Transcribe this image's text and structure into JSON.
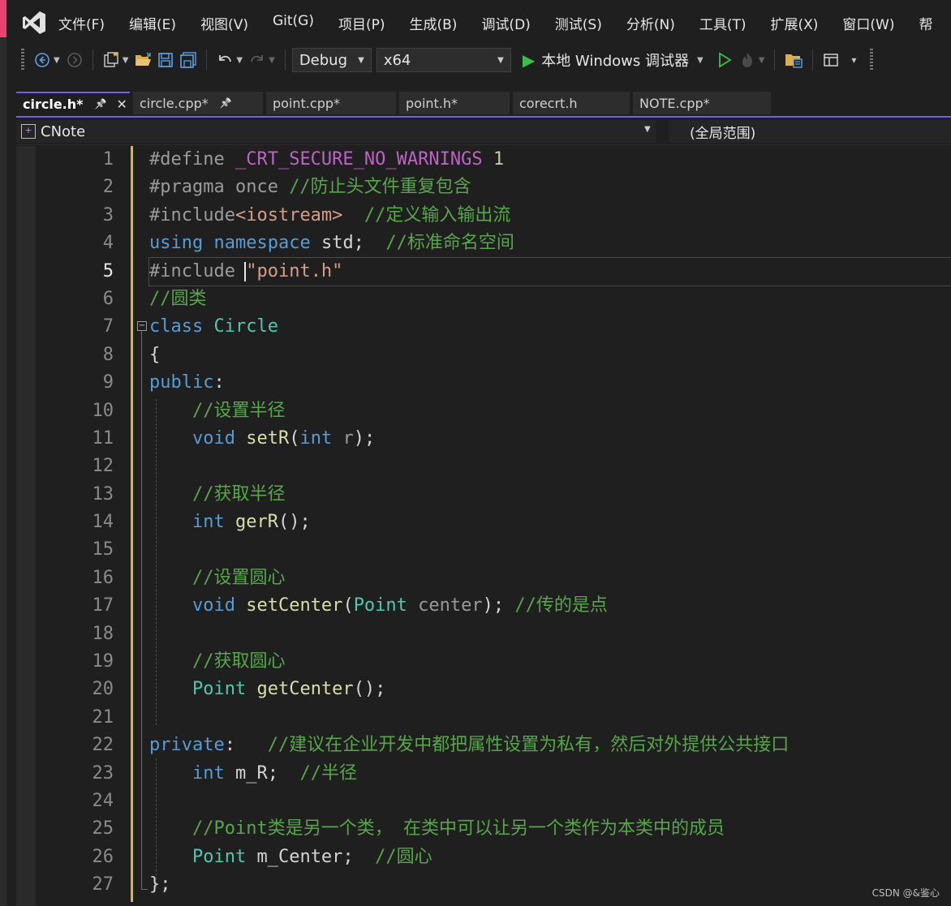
{
  "menu": [
    "文件(F)",
    "编辑(E)",
    "视图(V)",
    "Git(G)",
    "项目(P)",
    "生成(B)",
    "调试(D)",
    "测试(S)",
    "分析(N)",
    "工具(T)",
    "扩展(X)",
    "窗口(W)",
    "帮"
  ],
  "toolbar": {
    "config": "Debug",
    "platform": "x64",
    "run_label": "本地 Windows 调试器"
  },
  "tabs": [
    {
      "label": "circle.h*"
    },
    {
      "label": "circle.cpp*"
    },
    {
      "label": "point.cpp*"
    },
    {
      "label": "point.h*"
    },
    {
      "label": "corecrt.h"
    },
    {
      "label": "NOTE.cpp*"
    }
  ],
  "nav": {
    "class": "CNote",
    "scope": "(全局范围)"
  },
  "line_numbers": [
    "1",
    "2",
    "3",
    "4",
    "5",
    "6",
    "7",
    "8",
    "9",
    "10",
    "11",
    "12",
    "13",
    "14",
    "15",
    "16",
    "17",
    "18",
    "19",
    "20",
    "21",
    "22",
    "23",
    "24",
    "25",
    "26",
    "27"
  ],
  "code": [
    [
      {
        "t": "#define ",
        "c": "pp"
      },
      {
        "t": "_CRT_SECURE_NO_WARNINGS",
        "c": "mac"
      },
      {
        "t": " 1",
        "c": "num"
      }
    ],
    [
      {
        "t": "#pragma once ",
        "c": "pp"
      },
      {
        "t": "//防止头文件重复包含",
        "c": "cm"
      }
    ],
    [
      {
        "t": "#include",
        "c": "pp"
      },
      {
        "t": "<iostream>",
        "c": "inc"
      },
      {
        "t": "  ",
        "c": "pl"
      },
      {
        "t": "//定义输入输出流",
        "c": "cm"
      }
    ],
    [
      {
        "t": "using",
        "c": "kw"
      },
      {
        "t": " ",
        "c": "pl"
      },
      {
        "t": "namespace",
        "c": "kw"
      },
      {
        "t": " std;  ",
        "c": "pl"
      },
      {
        "t": "//标准命名空间",
        "c": "cm"
      }
    ],
    [
      {
        "t": "#include ",
        "c": "pp"
      },
      {
        "t": "\"point.h\"",
        "c": "str"
      }
    ],
    [
      {
        "t": "//圆类",
        "c": "cm"
      }
    ],
    [
      {
        "t": "class",
        "c": "kw"
      },
      {
        "t": " ",
        "c": "pl"
      },
      {
        "t": "Circle",
        "c": "ty"
      }
    ],
    [
      {
        "t": "{",
        "c": "pl"
      }
    ],
    [
      {
        "t": "public",
        "c": "kw"
      },
      {
        "t": ":",
        "c": "pl"
      }
    ],
    [
      {
        "t": "    ",
        "c": "pl"
      },
      {
        "t": "//设置半径",
        "c": "cm"
      }
    ],
    [
      {
        "t": "    ",
        "c": "pl"
      },
      {
        "t": "void",
        "c": "kw"
      },
      {
        "t": " ",
        "c": "pl"
      },
      {
        "t": "setR",
        "c": "fn"
      },
      {
        "t": "(",
        "c": "pl"
      },
      {
        "t": "int",
        "c": "kw"
      },
      {
        "t": " ",
        "c": "pl"
      },
      {
        "t": "r",
        "c": "par"
      },
      {
        "t": ");",
        "c": "pl"
      }
    ],
    [],
    [
      {
        "t": "    ",
        "c": "pl"
      },
      {
        "t": "//获取半径",
        "c": "cm"
      }
    ],
    [
      {
        "t": "    ",
        "c": "pl"
      },
      {
        "t": "int",
        "c": "kw"
      },
      {
        "t": " ",
        "c": "pl"
      },
      {
        "t": "gerR",
        "c": "fn"
      },
      {
        "t": "();",
        "c": "pl"
      }
    ],
    [],
    [
      {
        "t": "    ",
        "c": "pl"
      },
      {
        "t": "//设置圆心",
        "c": "cm"
      }
    ],
    [
      {
        "t": "    ",
        "c": "pl"
      },
      {
        "t": "void",
        "c": "kw"
      },
      {
        "t": " ",
        "c": "pl"
      },
      {
        "t": "setCenter",
        "c": "fn"
      },
      {
        "t": "(",
        "c": "pl"
      },
      {
        "t": "Point",
        "c": "ty"
      },
      {
        "t": " ",
        "c": "pl"
      },
      {
        "t": "center",
        "c": "par"
      },
      {
        "t": "); ",
        "c": "pl"
      },
      {
        "t": "//传的是点",
        "c": "cm"
      }
    ],
    [],
    [
      {
        "t": "    ",
        "c": "pl"
      },
      {
        "t": "//获取圆心",
        "c": "cm"
      }
    ],
    [
      {
        "t": "    ",
        "c": "pl"
      },
      {
        "t": "Point",
        "c": "ty"
      },
      {
        "t": " ",
        "c": "pl"
      },
      {
        "t": "getCenter",
        "c": "fn"
      },
      {
        "t": "();",
        "c": "pl"
      }
    ],
    [],
    [
      {
        "t": "private",
        "c": "kw"
      },
      {
        "t": ":   ",
        "c": "pl"
      },
      {
        "t": "//建议在企业开发中都把属性设置为私有，然后对外提供公共接口",
        "c": "cm"
      }
    ],
    [
      {
        "t": "    ",
        "c": "pl"
      },
      {
        "t": "int",
        "c": "kw"
      },
      {
        "t": " m_R;  ",
        "c": "pl"
      },
      {
        "t": "//半径",
        "c": "cm"
      }
    ],
    [],
    [
      {
        "t": "    ",
        "c": "pl"
      },
      {
        "t": "//Point类是另一个类， 在类中可以让另一个类作为本类中的成员",
        "c": "cm"
      }
    ],
    [
      {
        "t": "    ",
        "c": "pl"
      },
      {
        "t": "Point",
        "c": "ty"
      },
      {
        "t": " m_Center;  ",
        "c": "pl"
      },
      {
        "t": "//圆心",
        "c": "cm"
      }
    ],
    [
      {
        "t": "};",
        "c": "pl"
      }
    ]
  ],
  "current_line": 5,
  "watermark": "CSDN @&鉴心"
}
